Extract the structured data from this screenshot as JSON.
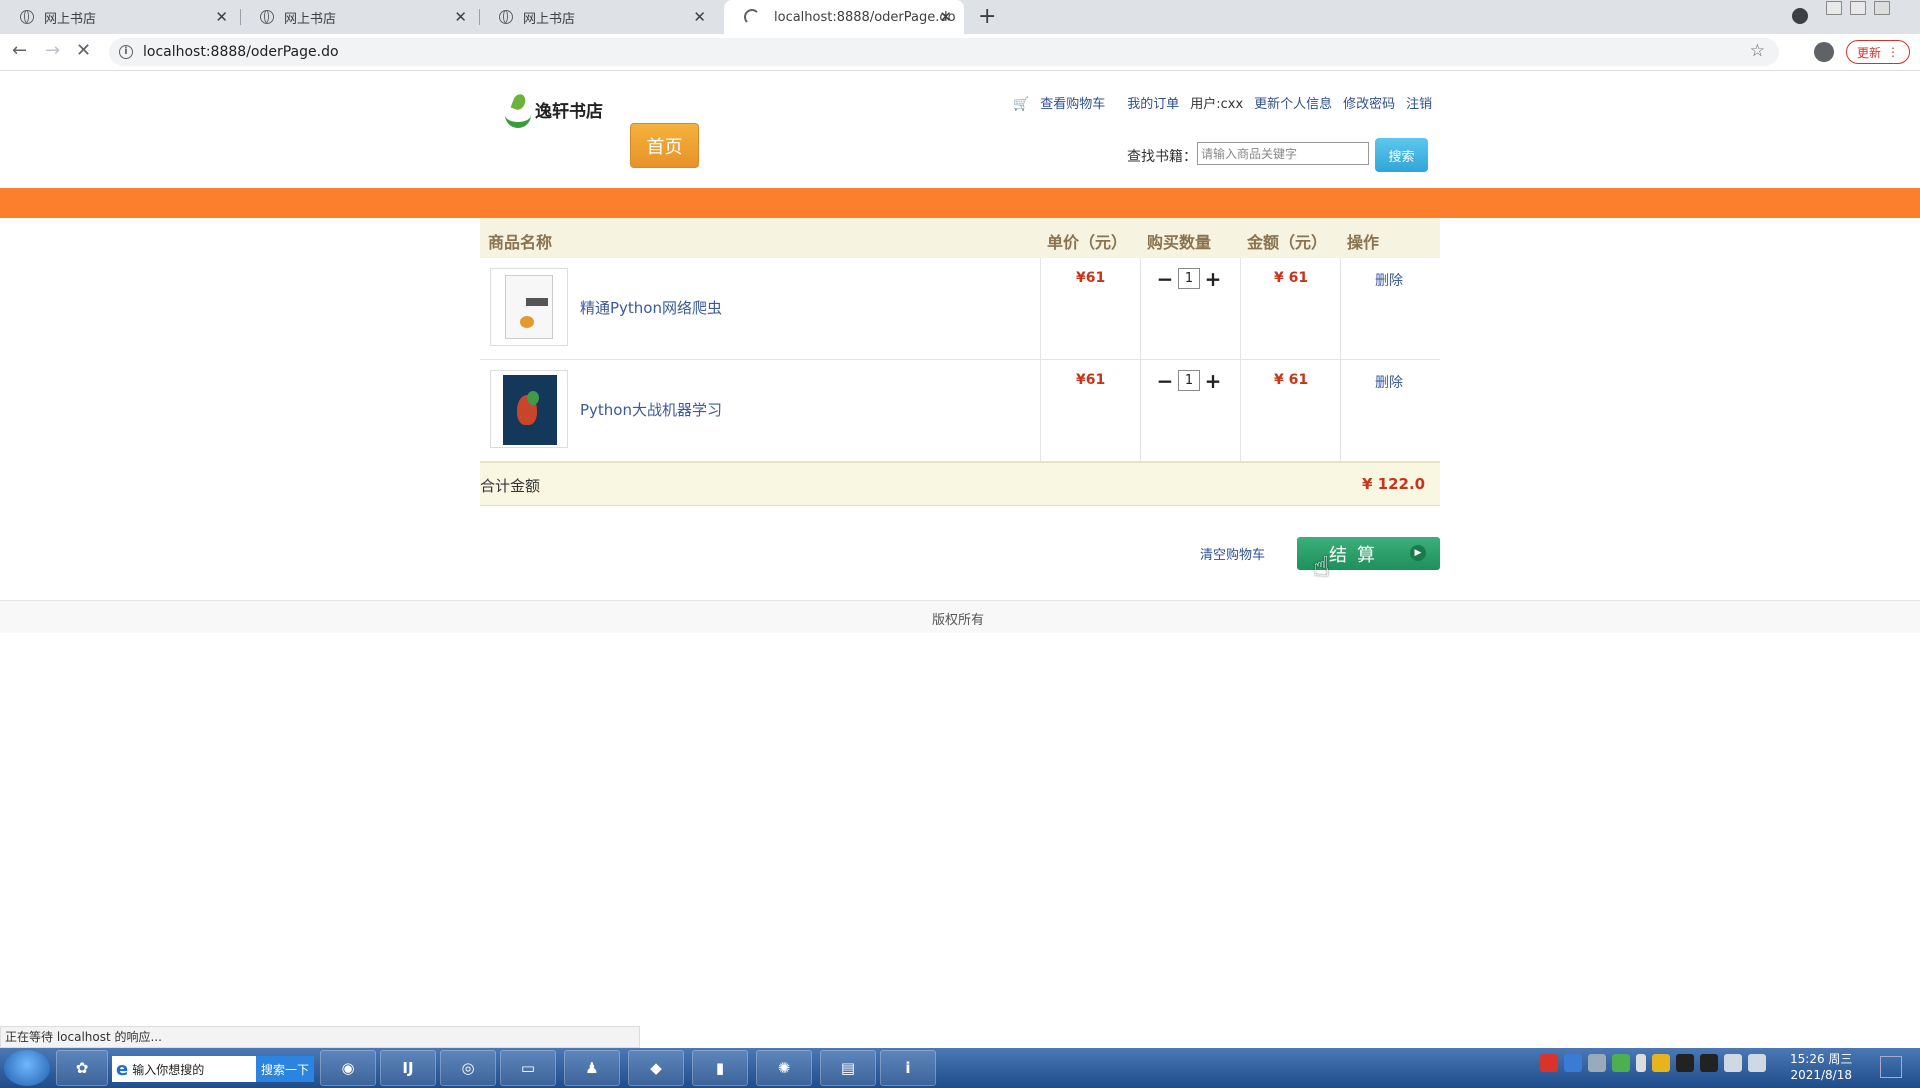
{
  "browser": {
    "tabs": [
      {
        "title": "网上书店"
      },
      {
        "title": "网上书店"
      },
      {
        "title": "网上书店"
      },
      {
        "title": "localhost:8888/oderPage.do"
      }
    ],
    "url": "localhost:8888/oderPage.do",
    "update_label": "更新",
    "status_text": "正在等待 localhost 的响应..."
  },
  "header": {
    "logo_text": "逸轩书店",
    "home_button": "首页",
    "links": {
      "cart": "查看购物车",
      "orders": "我的订单",
      "user": "用户:cxx",
      "update_info": "更新个人信息",
      "change_password": "修改密码",
      "logout": "注销"
    },
    "search": {
      "label": "查找书籍：",
      "placeholder": "请输入商品关键字",
      "button": "搜索"
    }
  },
  "cart": {
    "columns": {
      "name": "商品名称",
      "price": "单价（元）",
      "quantity": "购买数量",
      "amount": "金额（元）",
      "action": "操作"
    },
    "items": [
      {
        "name": "精通Python网络爬虫",
        "price": "¥61",
        "quantity": "1",
        "amount": "¥ 61",
        "action": "删除"
      },
      {
        "name": "Python大战机器学习",
        "price": "¥61",
        "quantity": "1",
        "amount": "¥ 61",
        "action": "删除"
      }
    ],
    "total_label": "合计金额",
    "total_value": "¥ 122.0",
    "clear_label": "清空购物车",
    "checkout_label": "结算"
  },
  "footer": {
    "copyright": "版权所有"
  },
  "taskbar": {
    "search_placeholder": "输入你想搜的",
    "search_button": "搜索一下",
    "time": "15:26 周三",
    "date": "2021/8/18"
  }
}
